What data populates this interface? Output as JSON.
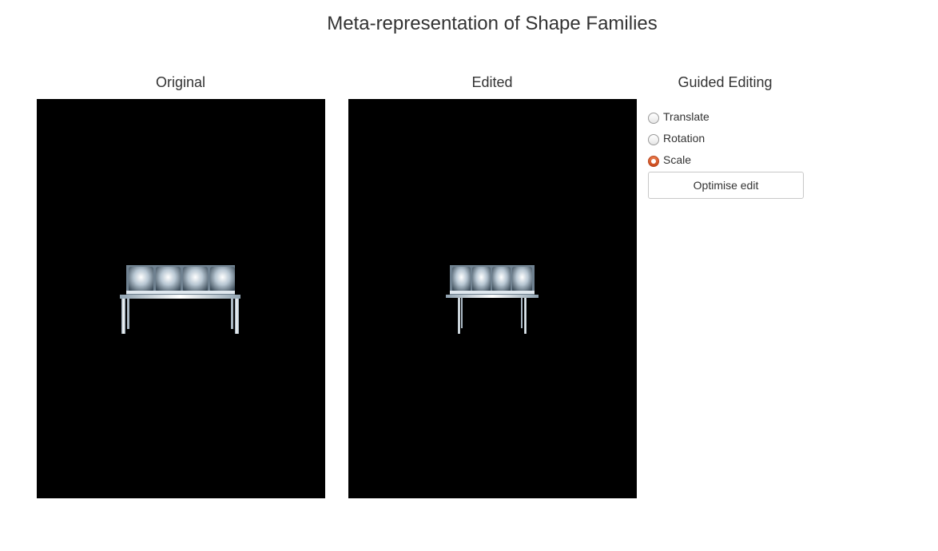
{
  "page": {
    "title": "Meta-representation of Shape Families"
  },
  "panels": {
    "original": {
      "title": "Original"
    },
    "edited": {
      "title": "Edited"
    },
    "guided": {
      "title": "Guided Editing"
    }
  },
  "guided_editing": {
    "options": [
      {
        "label": "Translate",
        "checked": false
      },
      {
        "label": "Rotation",
        "checked": false
      },
      {
        "label": "Scale",
        "checked": true
      }
    ],
    "optimise_button_label": "Optimise edit"
  },
  "colors": {
    "viewport_background": "#000000",
    "radio_accent": "#d9572a",
    "model_metal": "#c8d4de"
  }
}
